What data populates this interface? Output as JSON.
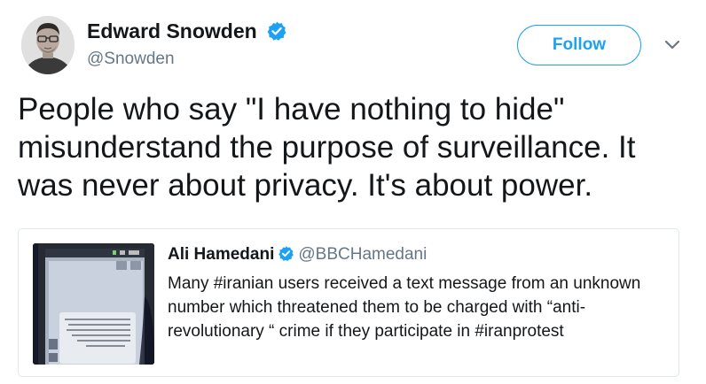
{
  "author": {
    "name": "Edward Snowden",
    "handle": "@Snowden",
    "verified": true
  },
  "actions": {
    "follow_label": "Follow",
    "menu_icon": "chevron-down-icon"
  },
  "tweet": {
    "text": "People who say \"I have nothing to hide\"\nmisunderstand the purpose of surveillance. It\nwas never about privacy. It's about power."
  },
  "quoted_tweet": {
    "name": "Ali Hamedani",
    "handle": "@BBCHamedani",
    "verified": true,
    "text": "Many #iranian users received a text message from an unknown number which threatened them to be charged with “anti-revolutionary “ crime if they participate in #iranprotest",
    "media_description": "phone-screen-sms-image"
  },
  "colors": {
    "accent": "#1da1f2",
    "text": "#14171a",
    "secondary": "#657786",
    "border": "#e1e8ed"
  }
}
